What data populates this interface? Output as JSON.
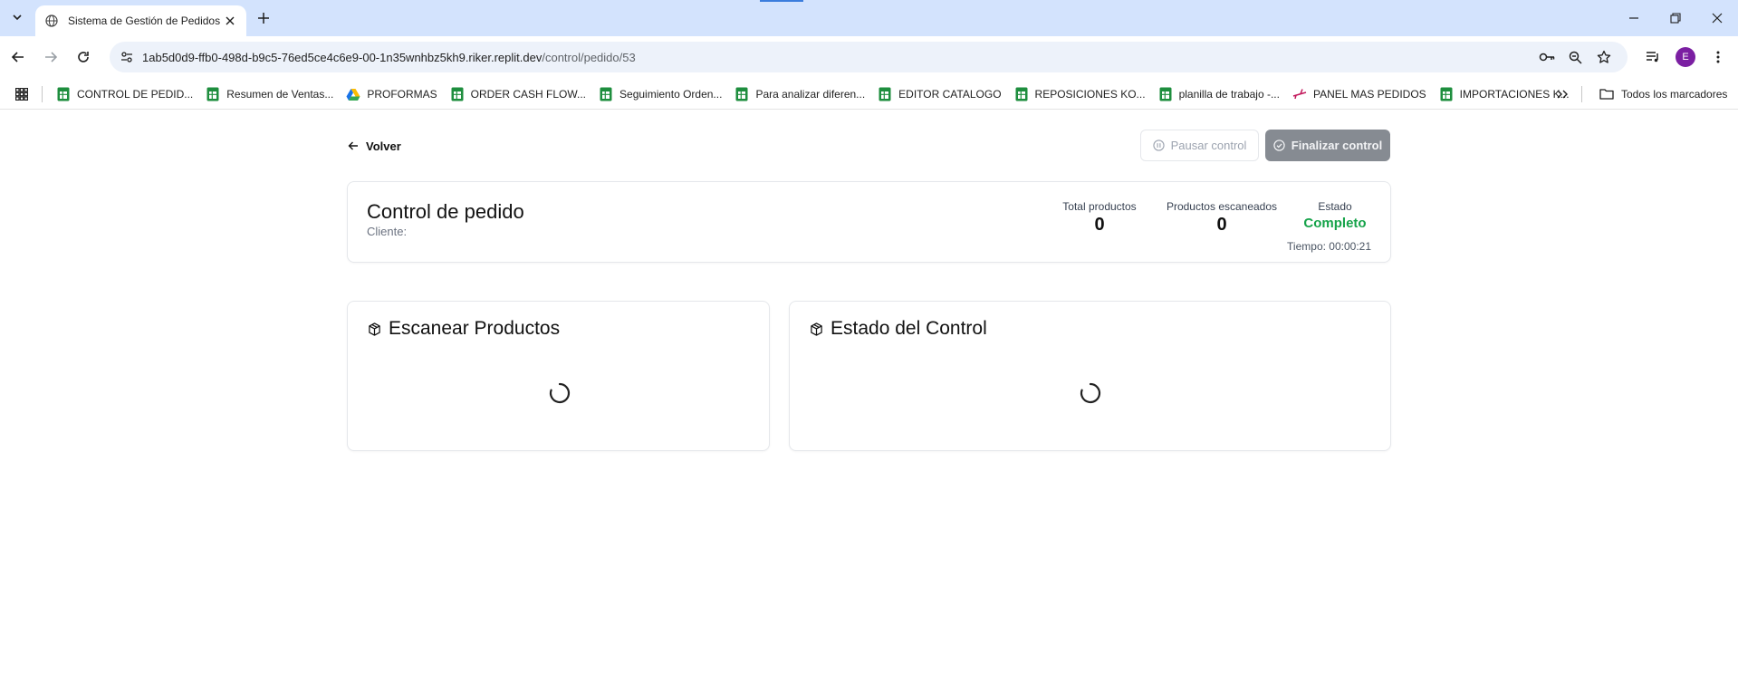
{
  "browser": {
    "tab": {
      "title": "Sistema de Gestión de Pedidos"
    },
    "url": {
      "host": "1ab5d0d9-ffb0-498d-b9c5-76ed5ce4c6e9-00-1n35wnhbz5kh9.riker.replit.dev",
      "path": "/control/pedido/53"
    },
    "avatar_letter": "E",
    "bookmarks": [
      {
        "label": "CONTROL DE PEDID...",
        "icon": "sheets-icon"
      },
      {
        "label": "Resumen de Ventas...",
        "icon": "sheets-icon"
      },
      {
        "label": "PROFORMAS",
        "icon": "drive-icon"
      },
      {
        "label": "ORDER CASH FLOW...",
        "icon": "sheets-icon"
      },
      {
        "label": "Seguimiento Orden...",
        "icon": "sheets-icon"
      },
      {
        "label": "Para analizar diferen...",
        "icon": "sheets-icon"
      },
      {
        "label": "EDITOR CATALOGO",
        "icon": "sheets-icon"
      },
      {
        "label": "REPOSICIONES KO...",
        "icon": "sheets-icon"
      },
      {
        "label": "planilla de trabajo -...",
        "icon": "sheets-icon"
      },
      {
        "label": "PANEL MAS PEDIDOS",
        "icon": "plane-icon"
      },
      {
        "label": "IMPORTACIONES K...",
        "icon": "sheets-icon"
      }
    ],
    "all_bookmarks_label": "Todos los marcadores"
  },
  "page": {
    "back_label": "Volver",
    "pause_label": "Pausar control",
    "finish_label": "Finalizar control",
    "order": {
      "title": "Control de pedido",
      "client_label": "Cliente:",
      "total_label": "Total productos",
      "total_value": "0",
      "scanned_label": "Productos escaneados",
      "scanned_value": "0",
      "status_label": "Estado",
      "status_value": "Completo",
      "time_text": "Tiempo: 00:00:21"
    },
    "scan_panel": {
      "title": "Escanear Productos"
    },
    "state_panel": {
      "title": "Estado del Control"
    }
  },
  "colors": {
    "tabstrip": "#d3e3fd",
    "status_green": "#16a34a",
    "finish_button": "#868b92"
  }
}
